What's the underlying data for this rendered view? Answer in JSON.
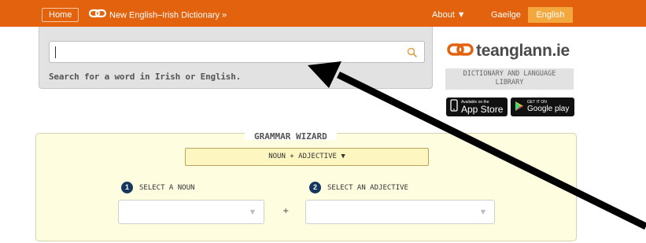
{
  "topbar": {
    "home_label": "Home",
    "dictionary_link": "New English–Irish Dictionary »",
    "about_label": "About ▼",
    "gaeilge_label": "Gaeilge",
    "english_label": "English"
  },
  "search": {
    "value": "",
    "hint": "Search for a word in Irish or English."
  },
  "brand": {
    "name": "teanglann.ie",
    "subtitle_line1": "DICTIONARY AND LANGUAGE",
    "subtitle_line2": "LIBRARY",
    "app_store_small": "Available on the",
    "app_store_big": "App Store",
    "google_play_small": "GET IT ON",
    "google_play_big": "Google play"
  },
  "wizard": {
    "title": "GRAMMAR WIZARD",
    "mode": "NOUN + ADJECTIVE ▼",
    "step1_num": "1",
    "step1_label": "SELECT A NOUN",
    "step2_num": "2",
    "step2_label": "SELECT AN ADJECTIVE",
    "plus": "+"
  },
  "colors": {
    "brand_orange": "#e2620e",
    "english_tab": "#f3a83d",
    "wizard_bg": "#fffde0",
    "step_badge": "#14375e"
  },
  "icons": [
    "chain-link-icon",
    "search-icon",
    "apple-icon",
    "google-play-icon",
    "dropdown-arrow-icon"
  ]
}
